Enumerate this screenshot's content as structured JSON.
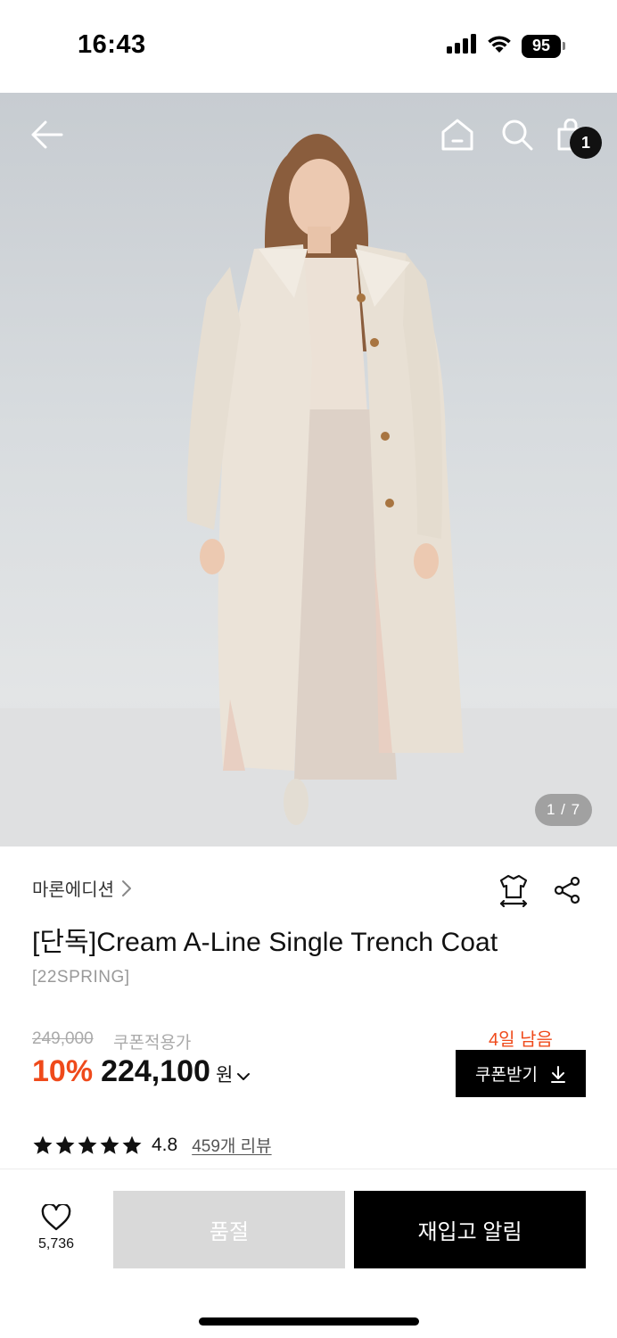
{
  "status_bar": {
    "time": "16:43",
    "battery": "95",
    "icons": [
      "cellular-signal-icon",
      "wifi-icon",
      "battery-icon"
    ]
  },
  "hero": {
    "page_indicator": "1 / 7",
    "cart_count": "1",
    "icons": [
      "back-arrow-icon",
      "home-icon",
      "search-icon",
      "shopping-bag-icon"
    ]
  },
  "product": {
    "brand": "마론에디션",
    "title": "[단독]Cream A-Line Single Trench Coat",
    "season": "[22SPRING]",
    "original_price": "249,000",
    "coupon_note": "쿠폰적용가",
    "discount": "10%",
    "sale_price": "224,100",
    "currency": "원",
    "days_left": "4일 남음",
    "coupon_button": "쿠폰받기",
    "rating": "4.8",
    "stars": 5,
    "reviews": "459개 리뷰"
  },
  "bottom_bar": {
    "like_count": "5,736",
    "soldout_label": "품절",
    "restock_label": "재입고 알림"
  },
  "colors": {
    "accent": "#ef4a1b",
    "primary_button": "#000000",
    "disabled_button": "#d9d9d9"
  }
}
